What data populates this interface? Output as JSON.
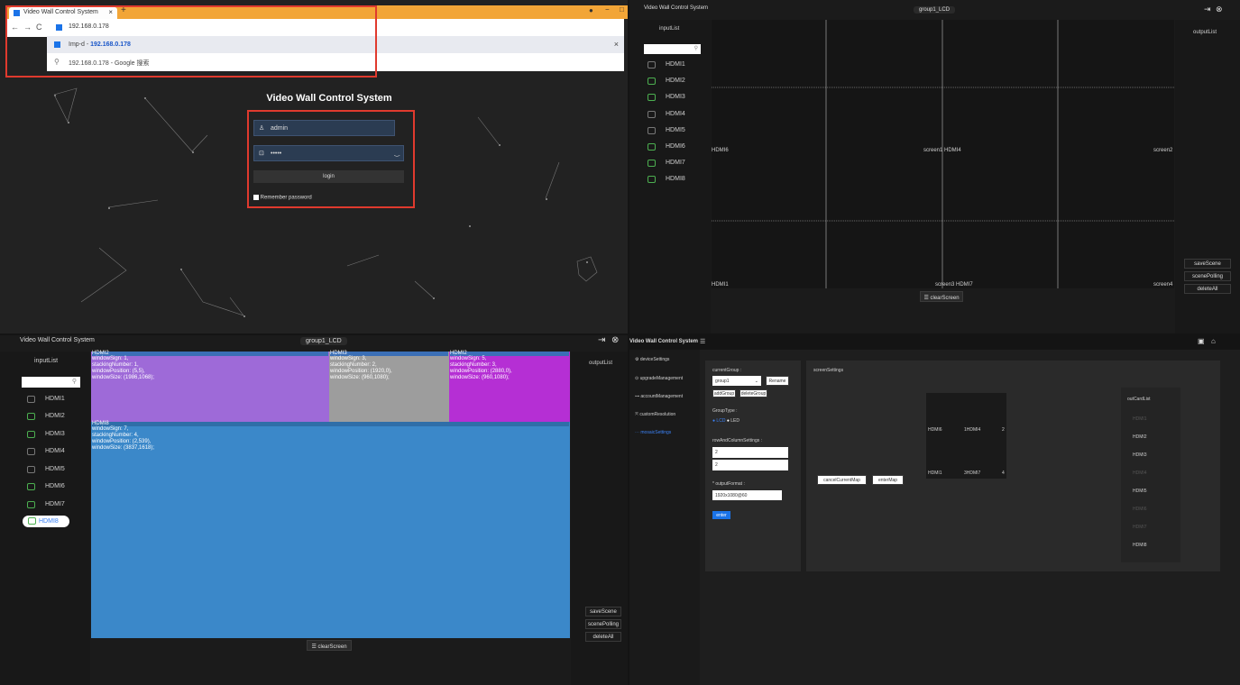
{
  "q1": {
    "tab_title": "Video Wall Control System",
    "url": "192.168.0.178",
    "suggest1_prefix": "Imp-d -",
    "suggest1_host": "192.168.0.178",
    "suggest2": "192.168.0.178 - Google 搜索",
    "heading": "Video Wall Control System",
    "username": "admin",
    "password": "•••••",
    "login_label": "login",
    "remember_label": "Remember password"
  },
  "q2": {
    "title": "Video Wall Control System",
    "group": "group1_LCD",
    "input_list": "inputList",
    "output_list": "outputList",
    "inputs": [
      "HDMI1",
      "HDMI2",
      "HDMI3",
      "HDMI4",
      "HDMI5",
      "HDMI6",
      "HDMI7",
      "HDMI8"
    ],
    "label_left_mid": "HDMI6",
    "label_center_mid": "screen1 HDMI4",
    "label_right_mid": "screen2",
    "label_left_bot": "HDMI1",
    "label_center_bot": "screen3 HDMI7",
    "label_right_bot": "screen4",
    "clear": "☰ clearScreen",
    "save": "saveScene",
    "polling": "scenePolling",
    "delete": "deleteAll"
  },
  "q3": {
    "title": "Video Wall Control System",
    "group": "group1_LCD",
    "input_list": "inputList",
    "output_list": "outputList",
    "inputs": [
      "HDMI1",
      "HDMI2",
      "HDMI3",
      "HDMI4",
      "HDMI5",
      "HDMI6",
      "HDMI7",
      "HDMI8"
    ],
    "w1": {
      "name": "HDMI2",
      "l1": "windowSign: 1,",
      "l2": "stackingNumber: 1,",
      "l3": "windowPosition: (5,5),",
      "l4": "windowSize: (1986,1068);"
    },
    "w2": {
      "name": "HDMI3",
      "l1": "windowSign: 3,",
      "l2": "stackingNumber: 2,",
      "l3": "windowPosition: (1920,0),",
      "l4": "windowSize: (960,1080);"
    },
    "w3": {
      "name": "HDMI2",
      "l1": "windowSign: 5,",
      "l2": "stackingNumber: 3,",
      "l3": "windowPosition: (2880,0),",
      "l4": "windowSize: (960,1080);"
    },
    "w4": {
      "name": "HDMI8",
      "l1": "windowSign: 7,",
      "l2": "stackingNumber: 4,",
      "l3": "windowPosition: (2,539),",
      "l4": "windowSize: (3837,1618);"
    },
    "clear": "☰ clearScreen",
    "save": "saveScene",
    "polling": "scenePolling",
    "delete": "deleteAll"
  },
  "q4": {
    "title": "Video Wall Control System",
    "menu": [
      "deviceSettings",
      "upgradeManagement",
      "accountManagement",
      "customResolution",
      "mosaicSettings"
    ],
    "current_group_label": "currentGroup :",
    "group_value": "group1",
    "rename": "Rename",
    "add_group": "addGroup",
    "delete_group": "deleteGroup",
    "group_type_label": "GroupType :",
    "lcd": "LCD",
    "led": "LED",
    "rowcol_label": "rowAndColumnSettings :",
    "rows": "2",
    "cols": "2",
    "output_format_label": "* outputFormat :",
    "output_format": "1920x1080@60",
    "enter": "enter",
    "screen_settings": "screenSettings",
    "cells": [
      "HDMI6",
      "1HDMI4",
      "2",
      "HDMI1",
      "3HDMI7",
      "4"
    ],
    "cancel_map": "cancelCurrentMap",
    "enter_map": "enterMap",
    "out_card_list": "outCardList",
    "out_cards": [
      "HDMI1",
      "HDMI2",
      "HDMI3",
      "HDMI4",
      "HDMI5",
      "HDMI6",
      "HDMI7",
      "HDMI8"
    ]
  }
}
